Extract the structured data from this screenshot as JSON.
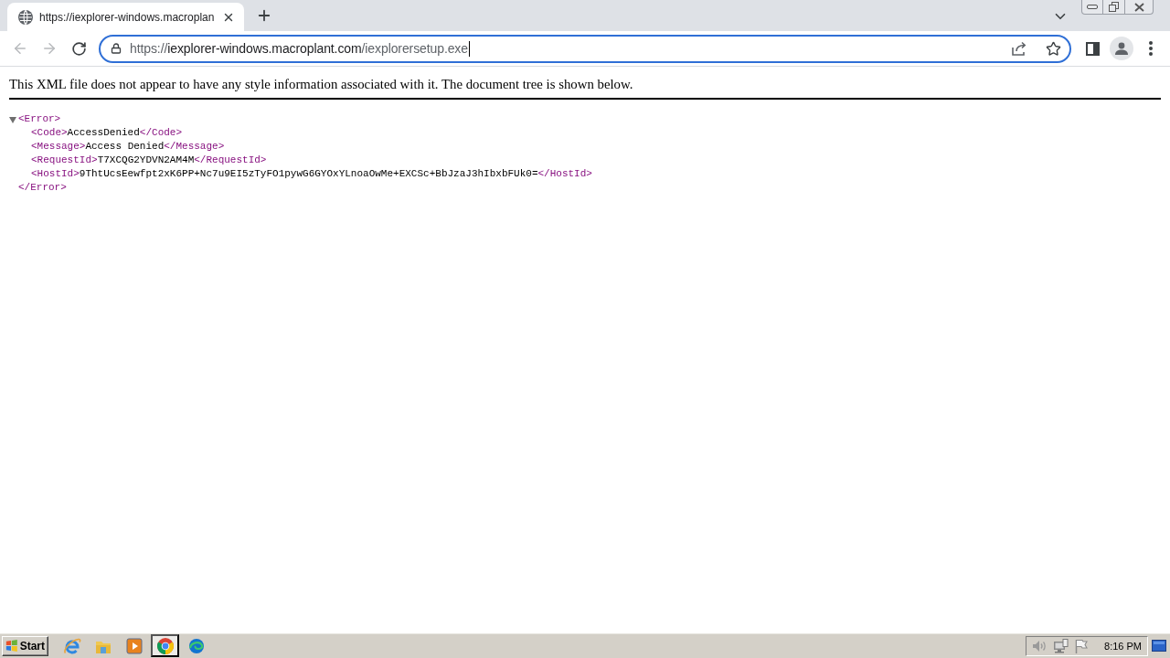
{
  "browser": {
    "tabs": [
      {
        "title": "https://iexplorer-windows.macroplan",
        "selected": true
      }
    ],
    "toolbar": {
      "back": {
        "disabled": true
      },
      "forward": {
        "disabled": true
      }
    },
    "address_bar": {
      "scheme": "https://",
      "host": "iexplorer-windows.macroplant.com",
      "path": "/iexplorersetup.exe",
      "focused": true
    }
  },
  "page": {
    "notice": "This XML file does not appear to have any style information associated with it. The document tree is shown below.",
    "xml_tree": {
      "open_tag": "<Error>",
      "close_tag": "</Error>",
      "expanded": true,
      "children": [
        {
          "open_tag": "<Code>",
          "text": "AccessDenied",
          "close_tag": "</Code>"
        },
        {
          "open_tag": "<Message>",
          "text": "Access Denied",
          "close_tag": "</Message>"
        },
        {
          "open_tag": "<RequestId>",
          "text": "T7XCQG2YDVN2AM4M",
          "close_tag": "</RequestId>"
        },
        {
          "open_tag": "<HostId>",
          "text": "9ThtUcsEewfpt2xK6PP+Nc7u9EI5zTyFO1pywG6GYOxYLnoaOwMe+EXCSc+BbJzaJ3hIbxbFUk0=",
          "close_tag": "</HostId>"
        }
      ]
    }
  },
  "taskbar": {
    "start_label": "Start",
    "apps": [
      {
        "kind": "internet-explorer",
        "selected": false
      },
      {
        "kind": "file-explorer",
        "selected": false
      },
      {
        "kind": "media-player",
        "selected": false
      },
      {
        "kind": "chrome",
        "selected": true
      },
      {
        "kind": "edge",
        "selected": false
      }
    ],
    "clock": "8:16 PM"
  }
}
